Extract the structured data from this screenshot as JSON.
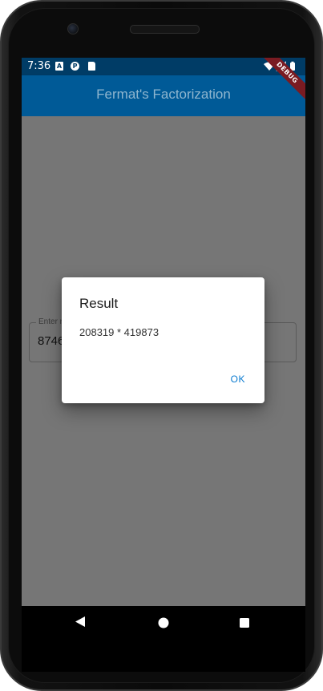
{
  "status_bar": {
    "time": "7:36",
    "icons": [
      "accessibility-a-icon",
      "notification-p-icon",
      "sd-card-icon",
      "wifi-icon",
      "signal-icon",
      "battery-icon"
    ]
  },
  "debug_banner": "DEBUG",
  "app_bar": {
    "title": "Fermat's Factorization"
  },
  "text_field": {
    "label": "Enter n",
    "value": "8746"
  },
  "dialog": {
    "title": "Result",
    "body": "208319 * 419873",
    "ok_label": "OK"
  },
  "nav": {
    "back": "back-icon",
    "home": "home-icon",
    "recents": "recents-icon"
  },
  "colors": {
    "status_bar": "#003c66",
    "app_bar": "#005a97",
    "accent": "#0a7bd0",
    "debug_ribbon": "#7a1b22"
  }
}
